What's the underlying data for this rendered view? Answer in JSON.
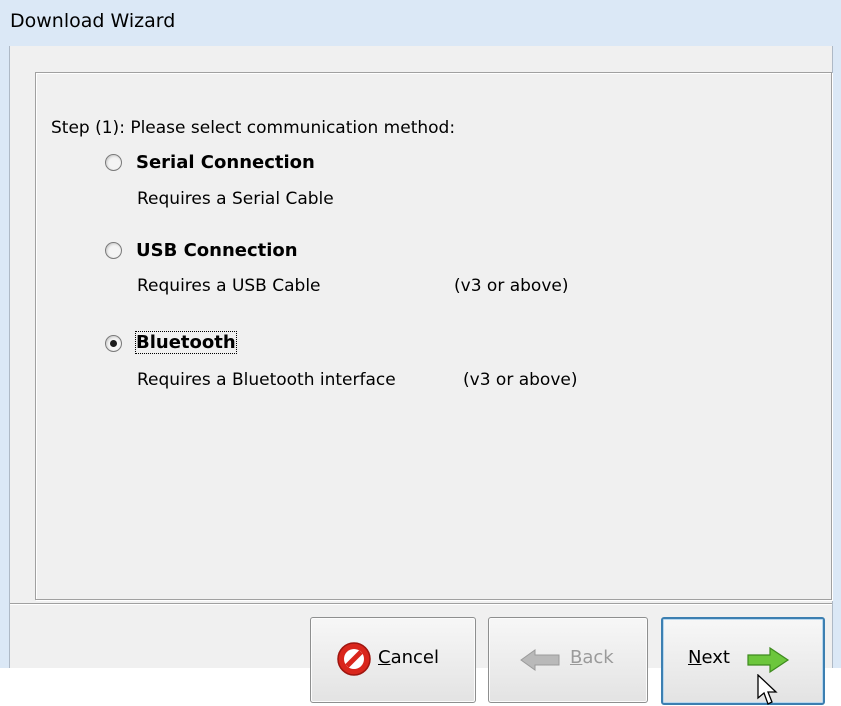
{
  "window": {
    "title": "Download Wizard"
  },
  "step_label": "Step (1): Please select communication method:",
  "options": [
    {
      "title": "Serial Connection",
      "description": "Requires a Serial Cable",
      "version": "",
      "selected": false
    },
    {
      "title": "USB Connection",
      "description": "Requires a USB Cable",
      "version": "(v3 or above)",
      "selected": false
    },
    {
      "title": "Bluetooth",
      "description": "Requires a Bluetooth interface",
      "version": "(v3 or above)",
      "selected": true
    }
  ],
  "buttons": {
    "cancel": {
      "mnemonic": "C",
      "rest": "ancel",
      "icon": "cancel-icon",
      "enabled": true
    },
    "back": {
      "mnemonic": "B",
      "rest": "ack",
      "icon": "back-arrow-icon",
      "enabled": false
    },
    "next": {
      "mnemonic": "N",
      "rest": "ext",
      "icon": "next-arrow-icon",
      "enabled": true,
      "default": true
    }
  },
  "colors": {
    "title_bar": "#dbe8f6",
    "next_arrow": "#5fba34",
    "cancel_icon": "#d9261c"
  }
}
